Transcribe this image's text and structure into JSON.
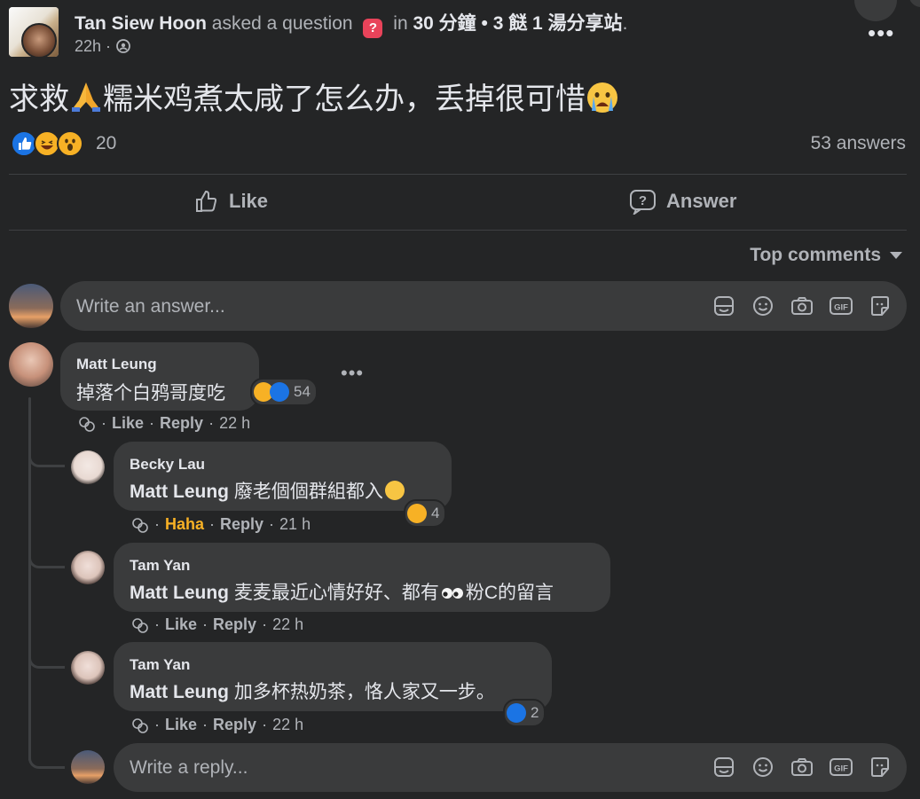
{
  "post": {
    "author": "Tan Siew Hoon",
    "action_text": "asked a question",
    "in_text": "in",
    "group": "30 分鐘 • 3 餸 1 湯分享站",
    "group_trailing": ".",
    "time": "22h",
    "privacy_icon": "group-icon",
    "more_label": "•••",
    "question_text_1": "求救",
    "question_text_2": "糯米鸡煮太咸了怎么办，丢掉很可惜",
    "reaction_count": "20",
    "answers_count": "53 answers"
  },
  "actions": {
    "like": "Like",
    "answer": "Answer"
  },
  "sort": {
    "label": "Top comments"
  },
  "composer": {
    "placeholder": "Write an answer..."
  },
  "reply_composer": {
    "placeholder": "Write a reply..."
  },
  "composer_icons": [
    "sticker-icon",
    "emoji-icon",
    "camera-icon",
    "gif-icon",
    "avatar-sticker-icon"
  ],
  "comments": [
    {
      "name": "Matt Leung",
      "text": "掉落个白鸦哥度吃",
      "reaction_count": "54",
      "like": "Like",
      "reply": "Reply",
      "time": "22 h"
    }
  ],
  "replies": [
    {
      "name": "Becky Lau",
      "tag": "Matt Leung",
      "text": "廢老個個群組都入",
      "reaction_count": "4",
      "reaction_label": "Haha",
      "reply": "Reply",
      "time": "21 h"
    },
    {
      "name": "Tam Yan",
      "tag": "Matt Leung",
      "text": "麦麦最近心情好好、都有",
      "text2": "粉C的留言",
      "like": "Like",
      "reply": "Reply",
      "time": "22 h"
    },
    {
      "name": "Tam Yan",
      "tag": "Matt Leung",
      "text": "加多杯热奶茶，恪人家又一步。",
      "reaction_count": "2",
      "like": "Like",
      "reply": "Reply",
      "time": "22 h"
    }
  ],
  "colors": {
    "background": "#242526",
    "bubble": "#3a3b3c",
    "accent_blue": "#1b74e4",
    "haha_yellow": "#f7b125",
    "muted": "#b0b3b8"
  }
}
